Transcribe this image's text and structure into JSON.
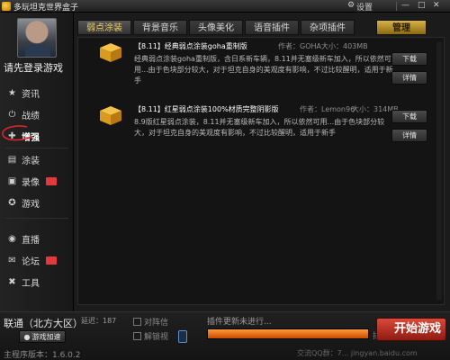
{
  "window": {
    "title": "多玩坦克世界盒子",
    "settings_label": "设置",
    "minimize_label": "—",
    "maximize_label": "□",
    "close_label": "✕"
  },
  "sidebar": {
    "login_prompt": "请先登录游戏",
    "items": [
      {
        "label": "资讯",
        "icon": "star-icon"
      },
      {
        "label": "战绩",
        "icon": "power-icon"
      },
      {
        "label": "增强",
        "icon": "puzzle-icon"
      },
      {
        "label": "涂装",
        "icon": "paint-icon"
      },
      {
        "label": "录像",
        "icon": "film-icon"
      },
      {
        "label": "游戏",
        "icon": "gamepad-icon"
      },
      {
        "label": "直播",
        "icon": "broadcast-icon"
      },
      {
        "label": "论坛",
        "icon": "chat-icon"
      },
      {
        "label": "工具",
        "icon": "wrench-icon"
      }
    ]
  },
  "tabs": [
    {
      "label": "弱点涂装",
      "state": "selected"
    },
    {
      "label": "背景音乐",
      "state": "normal"
    },
    {
      "label": "头像美化",
      "state": "normal"
    },
    {
      "label": "语音插件",
      "state": "normal"
    },
    {
      "label": "杂项插件",
      "state": "normal"
    },
    {
      "label": "管理",
      "state": "accent"
    }
  ],
  "plugins": [
    {
      "title": "【8.11】经典弱点涂装goha重制版",
      "author": "作者：GOHA",
      "size": "大小：403MB",
      "description": "经典弱点涂装goha重制版，含日系新车辆，8.11并无塞级新车加入，所以依然可用...由于色块部分较大，对于坦克自身的美观度有影响，不过比较醒明，适用于新手",
      "download_label": "下载",
      "details_label": "详情"
    },
    {
      "title": "【8.11】红星弱点涂装100%材质完整阴影版",
      "author": "作者：Lemon96",
      "size": "大小：314MB",
      "description": "8.9版红星弱点涂装，8.11并无塞级新车加入，所以依然可用...由于色块部分较大，对于坦克自身的美观度有影响，不过比较醒明，适用于新手",
      "download_label": "下载",
      "details_label": "详情"
    }
  ],
  "bottom": {
    "server": "联通（北方大区）",
    "latency": "延迟：187",
    "accelerate_label": "游戏加速",
    "check_formation": "对阵信",
    "check_lock_view": "解锁视",
    "status": "插件更新未进行...",
    "progress_percent": 100,
    "progress_label": "插件",
    "start_label": "开始游戏",
    "version": "主程序版本：1.6.0.2",
    "footer": "交流QQ群：7... jingyan.baidu.com"
  },
  "colors": {
    "accent_gold": "#d6b24a",
    "start_red": "#d94a3a",
    "progress_orange": "#ff9b3a"
  }
}
